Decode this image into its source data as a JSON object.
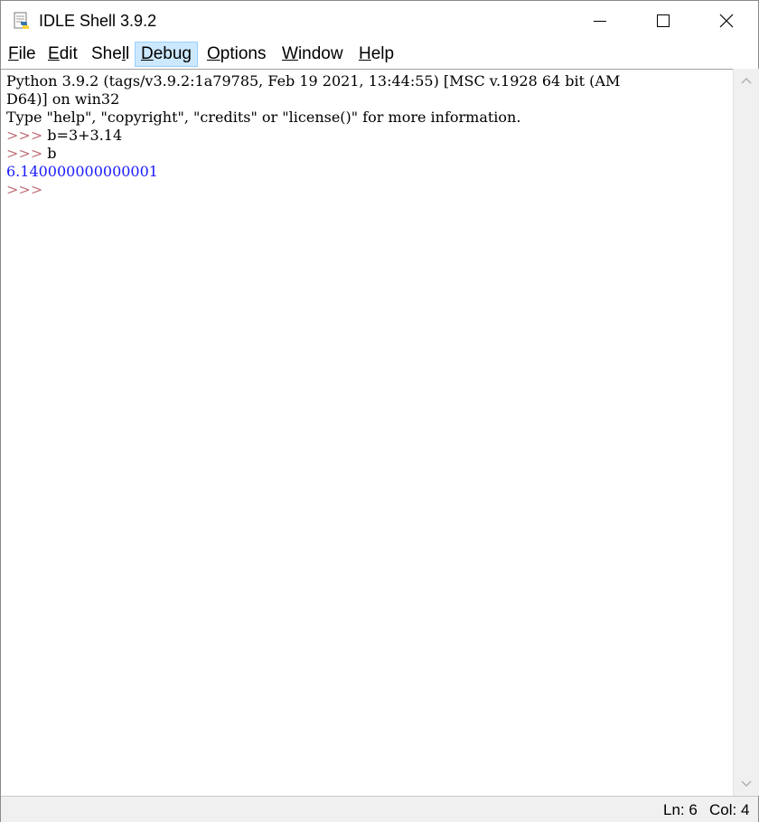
{
  "window": {
    "title": "IDLE Shell 3.9.2",
    "app_icon": "python-idle-icon",
    "controls": [
      "minimize-icon",
      "maximize-icon",
      "close-icon"
    ]
  },
  "menu": [
    {
      "label": "File",
      "underline": "F",
      "rest": "ile"
    },
    {
      "label": "Edit",
      "underline": "E",
      "rest": "dit"
    },
    {
      "label": "Shell",
      "pre": "She",
      "underline": "l",
      "rest": "l"
    },
    {
      "label": "Debug",
      "underline": "D",
      "rest": "ebug",
      "active": true
    },
    {
      "label": "Options",
      "underline": "O",
      "rest": "ptions"
    },
    {
      "label": "Window",
      "underline": "W",
      "rest": "indow"
    },
    {
      "label": "Help",
      "underline": "H",
      "rest": "elp"
    }
  ],
  "shell": {
    "banner_line1": "Python 3.9.2 (tags/v3.9.2:1a79785, Feb 19 2021, 13:44:55) [MSC v.1928 64 bit (AM",
    "banner_line2": "D64)] on win32",
    "banner_line3": "Type \"help\", \"copyright\", \"credits\" or \"license()\" for more information.",
    "prompt": ">>>",
    "input1": " b=3+3.14",
    "input2": " b",
    "output1": "6.140000000000001",
    "colors": {
      "prompt": "#c0707a",
      "output": "#1a1aff",
      "text": "#000000"
    }
  },
  "status": {
    "ln": "Ln: 6",
    "col": "Col: 4"
  }
}
